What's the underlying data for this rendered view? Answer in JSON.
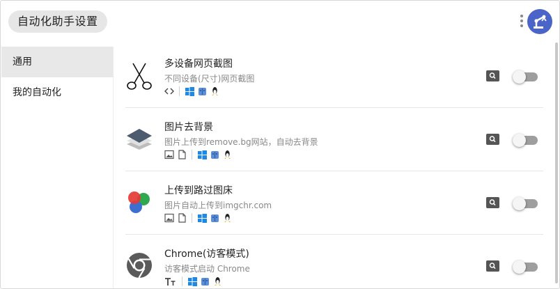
{
  "header": {
    "title": "自动化助手设置",
    "menu_icon": "more-vertical-icon",
    "avatar_icon": "robot-arm-icon",
    "avatar_color": "#4a64c8"
  },
  "sidebar": {
    "items": [
      {
        "label": "通用",
        "active": true
      },
      {
        "label": "我的自动化",
        "active": false
      }
    ]
  },
  "automations": [
    {
      "name": "多设备网页截图",
      "description": "不同设备(尺寸)网页截图",
      "icon": "scissors-icon",
      "tags": [
        "code-icon",
        "windows-icon",
        "apple-icon",
        "linux-icon"
      ],
      "enabled": false
    },
    {
      "name": "图片去背景",
      "description": "图片上传到remove.bg网站，自动去背景",
      "icon": "layers-icon",
      "tags": [
        "image-icon",
        "file-icon",
        "windows-icon",
        "apple-icon",
        "linux-icon"
      ],
      "enabled": false
    },
    {
      "name": "上传到路过图床",
      "description": "图片自动上传到imgchr.com",
      "icon": "color-circles-icon",
      "tags": [
        "image-icon",
        "file-icon",
        "windows-icon",
        "apple-icon",
        "linux-icon"
      ],
      "enabled": false
    },
    {
      "name": "Chrome(访客模式)",
      "description": "访客模式启动 Chrome",
      "icon": "chrome-icon",
      "tags": [
        "text-icon",
        "windows-icon",
        "apple-icon",
        "linux-icon"
      ],
      "enabled": false
    }
  ],
  "colors": {
    "accent": "#4a64c8",
    "windows": "#1e88e5",
    "toggle_off": "#9e9e9e"
  }
}
